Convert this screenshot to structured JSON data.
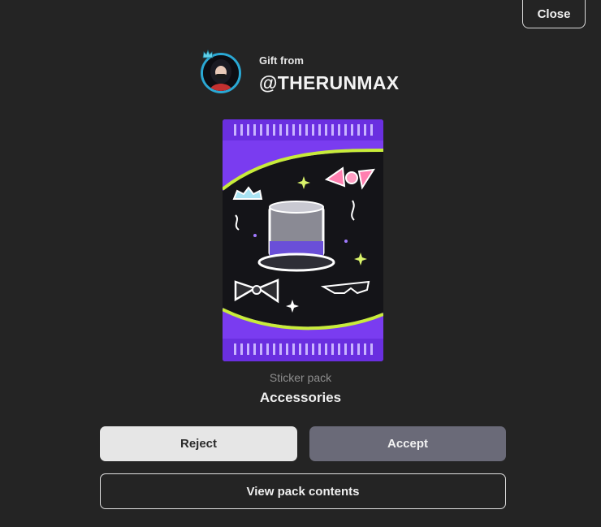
{
  "dialog": {
    "close_label": "Close"
  },
  "gift": {
    "from_label": "Gift from",
    "username": "@THERUNMAX"
  },
  "pack": {
    "type_label": "Sticker pack",
    "name": "Accessories",
    "icon": "sticker-pack-image"
  },
  "actions": {
    "reject_label": "Reject",
    "accept_label": "Accept",
    "view_contents_label": "View pack contents"
  },
  "colors": {
    "background": "#242424",
    "accept_button": "#6a6a78",
    "reject_button": "#e6e6e6",
    "avatar_ring": "#2aa8d4",
    "pack_purple": "#7a3cf0",
    "pack_lime": "#c8ec3a"
  }
}
